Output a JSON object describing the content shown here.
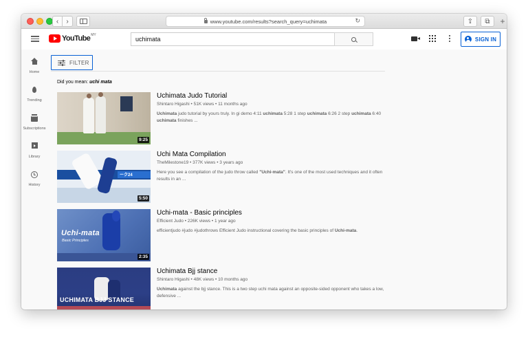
{
  "browser": {
    "url": "www.youtube.com/results?search_query=uchimata"
  },
  "masthead": {
    "logo_text": "YouTube",
    "region": "MY",
    "search_value": "uchimata",
    "sign_in_label": "SIGN IN"
  },
  "guide": {
    "items": [
      {
        "label": "Home",
        "icon": "home-icon"
      },
      {
        "label": "Trending",
        "icon": "trending-icon"
      },
      {
        "label": "Subscriptions",
        "icon": "subscriptions-icon"
      },
      {
        "label": "Library",
        "icon": "library-icon"
      },
      {
        "label": "History",
        "icon": "history-icon"
      }
    ]
  },
  "filter_label": "FILTER",
  "did_you_mean": {
    "prefix": "Did you mean:",
    "suggestion": "uchi mata"
  },
  "results": [
    {
      "title": "Uchimata Judo Tutorial",
      "channel": "Shintaro Higashi",
      "views": "51K views",
      "age": "11 months ago",
      "duration": "9:25",
      "description": "Uchimata judo tutorial by yours truly. In gi demo 4:11 uchimata 5:28 1 step uchimata 6:26 2 step uchimata 6:40 uchimata finishes ..."
    },
    {
      "title": "Uchi Mata Compilation",
      "channel": "TheMilestone19",
      "views": "377K views",
      "age": "3 years ago",
      "duration": "5:50",
      "description": "Here you see a compilation of the judo throw called \"Uchi-mata\". It's one of the most used techniques and it often results in an ...",
      "thumb_text": "ーク24"
    },
    {
      "title": "Uchi-mata - Basic principles",
      "channel": "Efficient Judo",
      "views": "226K views",
      "age": "1 year ago",
      "duration": "2:35",
      "description": "efficientjudo #judo #judothrows Efficient Judo instructional covering the basic principles of Uchi-mata.",
      "thumb_text": "Uchi-mata",
      "thumb_subtext": "Basic Principles"
    },
    {
      "title": "Uchimata Bjj stance",
      "channel": "Shintaro Higashi",
      "views": "48K views",
      "age": "10 months ago",
      "description": "Uchimata against the bjj stance. This is a two step uchi mata against an opposite-sided opponent who takes a low, defensive ...",
      "thumb_text": "UCHIMATA BJJ STANCE"
    }
  ],
  "colors": {
    "accent": "#065fd4",
    "logo_red": "#ff0000",
    "text_primary": "#030303",
    "text_secondary": "#606060"
  }
}
